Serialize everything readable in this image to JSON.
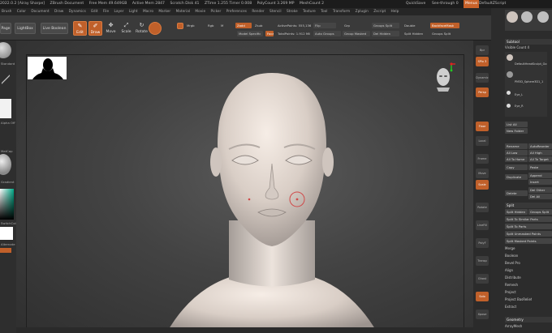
{
  "titlebar": {
    "items": [
      "2022.0.2 [Airay Sharpe]",
      "ZBrush Document",
      "Free Mem 49.649GB",
      "Active Mem 2847",
      "Scratch Disk 41",
      "ZTime 1.255 Timer 0.008",
      "PolyCount 3.269 MP",
      "MeshCount 2"
    ],
    "quicksave": "QuickSave",
    "seethrough": "See-through 0",
    "menus": "Menus",
    "default_script": "DefaultZScript"
  },
  "menubar": {
    "items": [
      "Brush",
      "Color",
      "Document",
      "Draw",
      "Dynamics",
      "Edit",
      "File",
      "Layer",
      "Light",
      "Macro",
      "Marker",
      "Material",
      "Movie",
      "Picker",
      "Preferences",
      "Render",
      "Stencil",
      "Stroke",
      "Texture",
      "Tool",
      "Transform",
      "Zplugin",
      "Zscript",
      "Help"
    ]
  },
  "shelf": {
    "page_label": "Page",
    "lightbox_label": "LightBox",
    "live_boolean_label": "Live Boolean",
    "edit_label": "Edit",
    "draw_label": "Draw",
    "move_label": "Move",
    "scale_label": "Scale",
    "rotate_label": "Rotate",
    "mrgb": "Mrgb",
    "rgb": "Rgb",
    "m": "M",
    "zadd": "Zadd",
    "zsub": "Zsub",
    "active_points": "ActivePoints: 555,136",
    "model_specific": "Model Specific",
    "total_points": "TotalPoints: 1.912 Mil",
    "flip": "Flip",
    "grp": "Grp",
    "groups_split": "Groups Split",
    "double": "Double",
    "backface_mask": "BackfaceMask",
    "auto_groups": "Auto Groups",
    "group_masked": "Group Masked",
    "del_hidden": "Del Hidden",
    "split_hidden": "Split Hidden",
    "groups_split_2": "Groups Split",
    "focal_shift": "Focal Shift 0",
    "draw_size": "Draw Size 64"
  },
  "leftbar": {
    "labels": [
      "Standard",
      "Alpha Off",
      "MatCap",
      "Gradient",
      "SwitchColor",
      "Alternate"
    ]
  },
  "panel": {
    "subtool_label": "Subtool",
    "visible_count": "Visible Count 4",
    "items": [
      {
        "name": "DefaultHeadSculpt_Go"
      },
      {
        "name": "PM3D_Sphere3D1_1"
      },
      {
        "name": "Eye_L"
      },
      {
        "name": "Eye_R"
      }
    ],
    "list_all": "List All",
    "new_folder": "New Folder",
    "rename": "Rename",
    "autoreorder": "AutoReorder",
    "all_low": "All Low",
    "all_high": "All High",
    "all_to_home": "All To Home",
    "all_to_target": "All To Target",
    "copy": "Copy",
    "paste": "Paste",
    "duplicate": "Duplicate",
    "append": "Append",
    "insert": "Insert",
    "delete": "Delete",
    "del_other": "Del Other",
    "del_all": "Del All",
    "split_head": "Split",
    "split_hidden": "Split Hidden",
    "groups_split": "Groups Split",
    "split_similar": "Split To Similar Parts",
    "split_parts": "Split To Parts",
    "split_unmasked": "Split Unmasked Points",
    "split_masked": "Split Masked Points",
    "merge": "Merge",
    "boolean": "Boolean",
    "bevel_pro": "Bevel Pro",
    "align": "Align",
    "distribute": "Distribute",
    "remesh": "Remesh",
    "project": "Project",
    "project_bas": "Project BasRelief",
    "extract": "Extract",
    "geometry": "Geometry",
    "array_mesh": "ArrayMesh"
  },
  "iconcol": {
    "labels": [
      "Bpr",
      "SPix 3",
      "Dynamic",
      "Persp",
      "Floor",
      "Local",
      "Frame",
      "Move",
      "Scale",
      "Rotate",
      "LineFill",
      "PolyF",
      "Transp",
      "Ghost",
      "Solo",
      "Xpose"
    ]
  },
  "colors": {
    "accent": "#c0602a",
    "bg": "#333333"
  }
}
